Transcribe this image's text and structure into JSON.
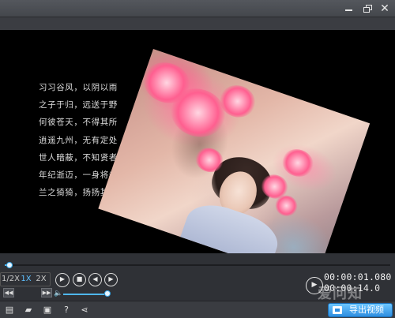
{
  "window": {
    "controls": {
      "minimize": "minimize",
      "maximize": "maximize",
      "close": "✕"
    }
  },
  "video": {
    "poem_lines": [
      "习习谷风，以阴以雨",
      "之子于归，远送于野",
      "何彼苍天，不得其所",
      "逍遥九州，无有定处",
      "世人暗蔽，不知贤者",
      "年纪逝迈，一身将老",
      "兰之猗猗，扬扬其香"
    ]
  },
  "playback": {
    "speed_options": [
      "1/2X",
      "1X",
      "2X"
    ],
    "active_speed": "1X",
    "progress_fraction": 0.02,
    "volume_fraction": 0.92
  },
  "time": {
    "current": "00:00:01.080",
    "total": "00:00:14.0"
  },
  "toolbar": {
    "export_label": "导出视频"
  },
  "watermark": {
    "text": "爱问知"
  },
  "colors": {
    "accent": "#4fb7f0",
    "export_button": "#2e8ee0"
  }
}
